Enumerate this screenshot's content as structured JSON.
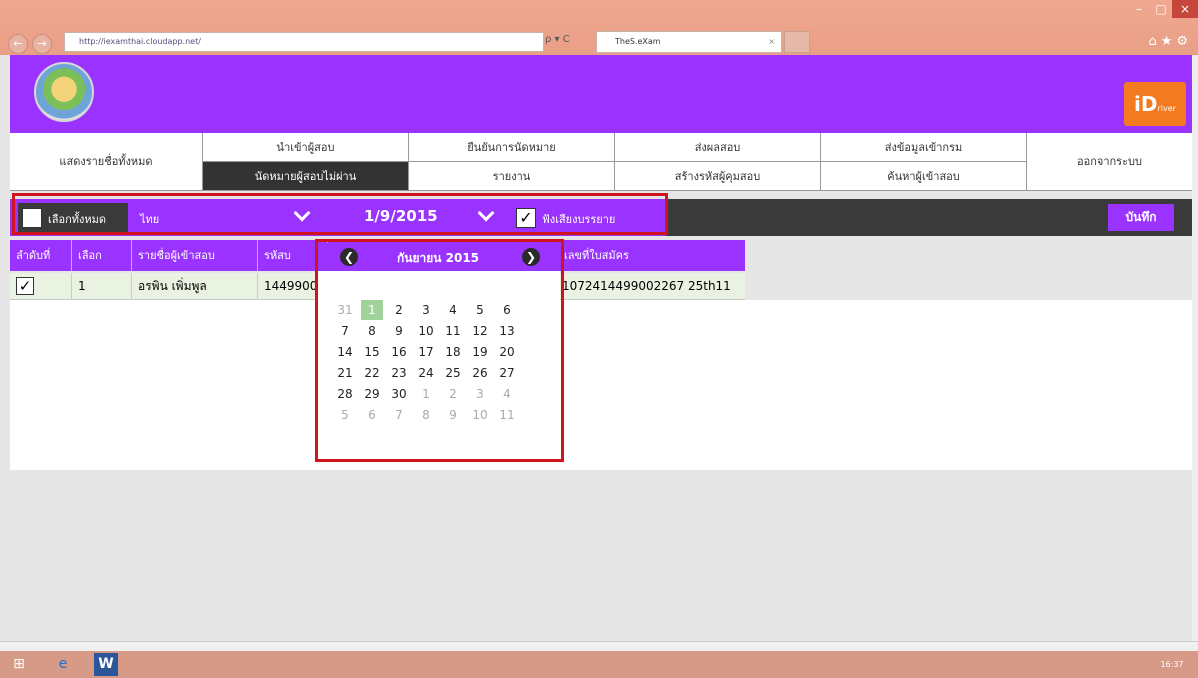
{
  "browser": {
    "url": "http://iexamthai.cloudapp.net/",
    "tab_title": "TheS.eXam",
    "addr_icons": "ρ ▾ C",
    "tab_close": "×",
    "back_glyph": "←",
    "forward_glyph": "→",
    "win_min": "–",
    "win_max": "□",
    "win_close": "×",
    "chrome_icons": "⌂★⚙"
  },
  "brand": {
    "main": "iD",
    "sub": "river"
  },
  "nav": {
    "show_all": "แสดงรายชื่อทั้งหมด",
    "row1": [
      "นำเข้าผู้สอบ",
      "ยืนยันการนัดหมาย",
      "ส่งผลสอบ",
      "ส่งข้อมูลเข้ากรม"
    ],
    "row2": [
      "นัดหมายผู้สอบไม่ผ่าน",
      "รายงาน",
      "สร้างรหัสผู้คุมสอบ",
      "ค้นหาผู้เข้าสอบ"
    ],
    "logout": "ออกจากระบบ"
  },
  "toolbar": {
    "select_all": "เลือกทั้งหมด",
    "language": "ไทย",
    "date": "1/9/2015",
    "listen_label": "ฟังเสียงบรรยาย",
    "save_label": "บันทึก"
  },
  "table": {
    "headers": [
      "ลำดับที่",
      "เลือก",
      "รายชื่อผู้เข้าสอบ",
      "รหัสบ",
      "เลขที่ใบสมัคร"
    ],
    "rows": [
      {
        "checked": true,
        "select": "1",
        "name": "อรพิน เพิ่มพูล",
        "code": "14499002",
        "application": "1072414499002267 25th11"
      }
    ]
  },
  "calendar": {
    "title": "กันยายน 2015",
    "prev": "❮",
    "next": "❯",
    "weeks": [
      [
        "31",
        "1",
        "2",
        "3",
        "4",
        "5",
        "6"
      ],
      [
        "7",
        "8",
        "9",
        "10",
        "11",
        "12",
        "13"
      ],
      [
        "14",
        "15",
        "16",
        "17",
        "18",
        "19",
        "20"
      ],
      [
        "21",
        "22",
        "23",
        "24",
        "25",
        "26",
        "27"
      ],
      [
        "28",
        "29",
        "30",
        "1",
        "2",
        "3",
        "4"
      ],
      [
        "5",
        "6",
        "7",
        "8",
        "9",
        "10",
        "11"
      ]
    ],
    "selected": "1"
  },
  "taskbar": {
    "word_label": "W",
    "clock": "16:37"
  },
  "colors": {
    "purple": "#9a33ff",
    "dark": "#3a3a3a",
    "highlight_red": "#d0141e",
    "selected_day": "#9fd39a"
  }
}
